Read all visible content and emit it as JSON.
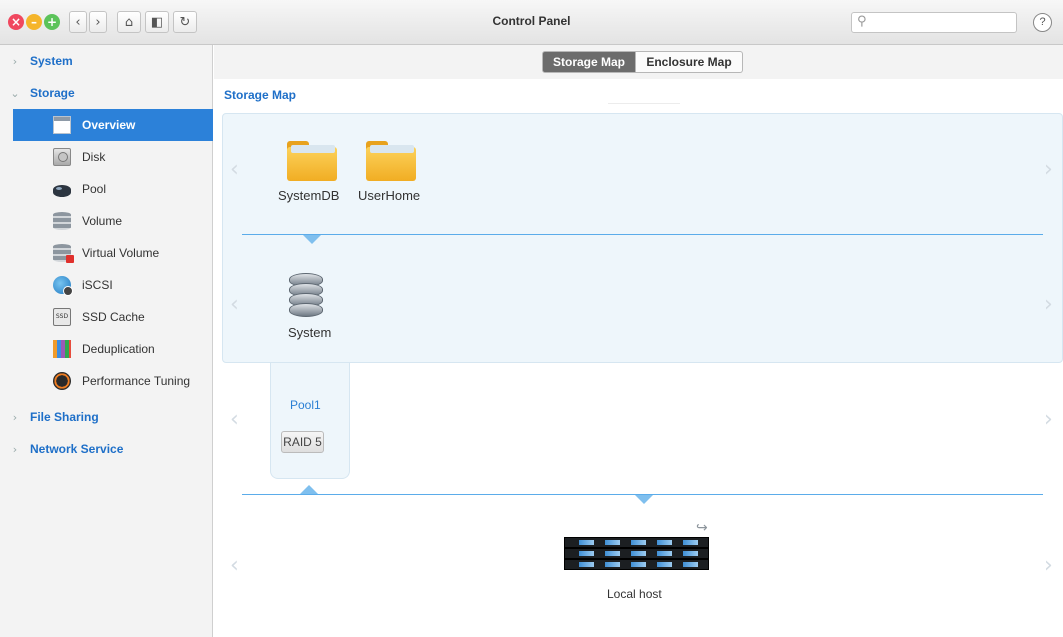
{
  "window": {
    "title": "Control Panel",
    "search_placeholder": "",
    "help_label": "?"
  },
  "toolbar": {
    "back_glyph": "‹",
    "forward_glyph": "›",
    "home_glyph": "⌂",
    "panel_glyph": "◧",
    "refresh_glyph": "↻"
  },
  "sidebar": {
    "sections": [
      {
        "label": "System",
        "expanded": false
      },
      {
        "label": "Storage",
        "expanded": true
      },
      {
        "label": "File Sharing",
        "expanded": false
      },
      {
        "label": "Network Service",
        "expanded": false
      }
    ],
    "storage_items": [
      {
        "label": "Overview",
        "icon": "overview-icon",
        "active": true
      },
      {
        "label": "Disk",
        "icon": "disk-icon",
        "active": false
      },
      {
        "label": "Pool",
        "icon": "pool-icon",
        "active": false
      },
      {
        "label": "Volume",
        "icon": "volume-icon",
        "active": false
      },
      {
        "label": "Virtual Volume",
        "icon": "virtual-volume-icon",
        "active": false
      },
      {
        "label": "iSCSI",
        "icon": "iscsi-icon",
        "active": false
      },
      {
        "label": "SSD Cache",
        "icon": "ssd-cache-icon",
        "active": false
      },
      {
        "label": "Deduplication",
        "icon": "deduplication-icon",
        "active": false
      },
      {
        "label": "Performance Tuning",
        "icon": "performance-tuning-icon",
        "active": false
      }
    ]
  },
  "main": {
    "tabs": [
      {
        "label": "Storage Map",
        "active": true
      },
      {
        "label": "Enclosure Map",
        "active": false
      }
    ],
    "section_title": "Storage Map",
    "shares": [
      {
        "label": "SystemDB",
        "icon": "folder-icon"
      },
      {
        "label": "UserHome",
        "icon": "folder-icon"
      }
    ],
    "volume": {
      "label": "System",
      "icon": "database-icon"
    },
    "pool": {
      "name": "Pool1",
      "raid": "RAID 5"
    },
    "host": {
      "label": "Local host",
      "icon": "server-icon"
    }
  },
  "colors": {
    "accent": "#2c81d9",
    "link": "#1e6fc8",
    "panel_bg": "#eef6fb",
    "connector": "#5bacea"
  }
}
